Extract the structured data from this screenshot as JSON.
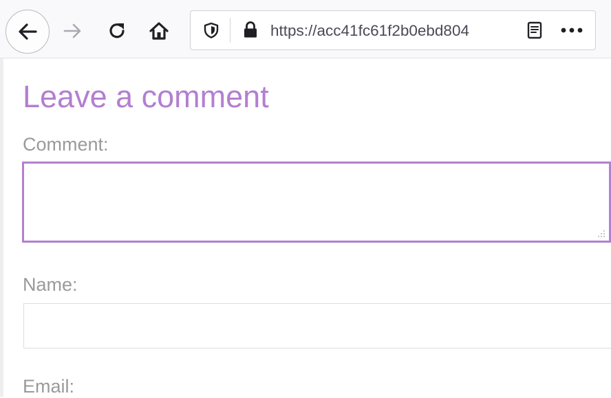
{
  "browser": {
    "url": "https://acc41fc61f2b0ebd804",
    "icons": {
      "back": "back-arrow-icon",
      "forward": "forward-arrow-icon",
      "reload": "reload-icon",
      "home": "home-icon",
      "shield": "tracking-shield-icon",
      "lock": "lock-icon",
      "reader": "reader-view-icon",
      "more": "more-actions-icon"
    }
  },
  "page": {
    "title": "Leave a comment",
    "accent_color": "#b37fd0",
    "comment": {
      "label": "Comment:",
      "value": ""
    },
    "name": {
      "label": "Name:",
      "value": ""
    },
    "email": {
      "label": "Email:"
    }
  }
}
